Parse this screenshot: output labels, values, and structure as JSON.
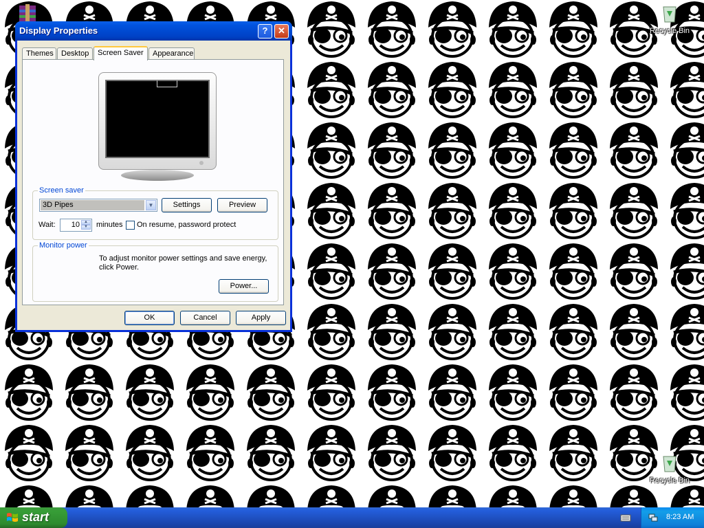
{
  "desktop": {
    "icons": [
      {
        "name": "winrar-icon",
        "label": ""
      },
      {
        "name": "recycle-bin-icon",
        "label": "Recycle Bin"
      },
      {
        "name": "recycle-bin-icon",
        "label": "Recycle Bin"
      }
    ]
  },
  "window": {
    "title": "Display Properties",
    "help_label": "?",
    "close_label": "✕",
    "tabs": [
      {
        "label": "Themes",
        "active": false
      },
      {
        "label": "Desktop",
        "active": false
      },
      {
        "label": "Screen Saver",
        "active": true
      },
      {
        "label": "Appearance",
        "active": false
      }
    ],
    "screen_saver": {
      "legend": "Screen saver",
      "selected": "3D Pipes",
      "settings_label": "Settings",
      "preview_label": "Preview",
      "wait_label": "Wait:",
      "wait_value": "10",
      "minutes_label": "minutes",
      "password_label": "On resume, password protect",
      "password_checked": false
    },
    "monitor_power": {
      "legend": "Monitor power",
      "description_line1": "To adjust monitor power settings and save energy,",
      "description_line2": "click Power.",
      "power_label": "Power..."
    },
    "buttons": {
      "ok": "OK",
      "cancel": "Cancel",
      "apply": "Apply"
    }
  },
  "taskbar": {
    "start_label": "start",
    "clock": "8:23 AM"
  },
  "colors": {
    "titlebar": "#0153de",
    "taskbar": "#245edb",
    "start": "#379d37",
    "tray": "#139ee9"
  }
}
